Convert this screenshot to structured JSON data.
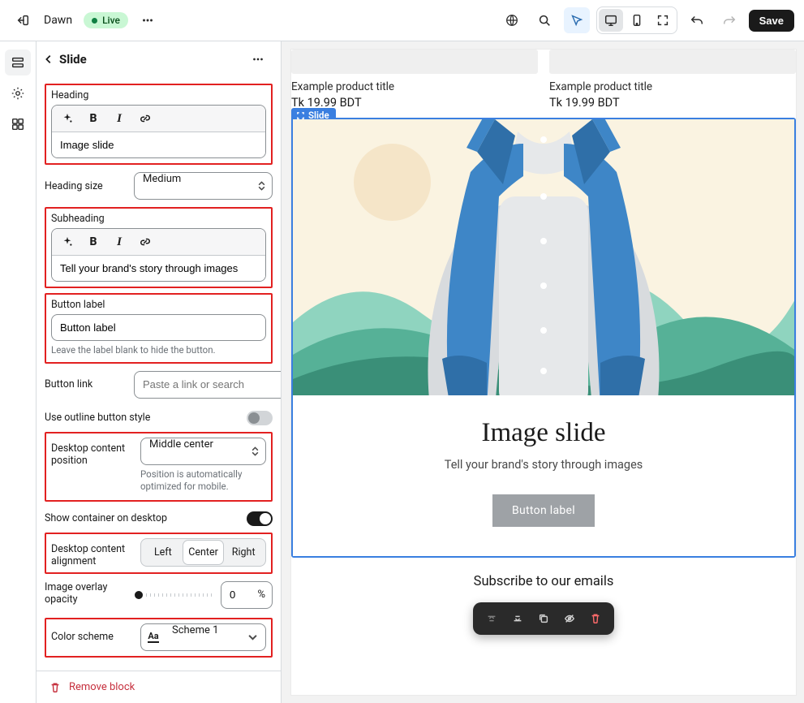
{
  "app": {
    "theme_name": "Dawn",
    "status_label": "Live",
    "save_label": "Save"
  },
  "sidebar": {
    "title": "Slide",
    "heading_label": "Heading",
    "heading_value": "Image slide",
    "heading_size_label": "Heading size",
    "heading_size_value": "Medium",
    "subheading_label": "Subheading",
    "subheading_value": "Tell your brand's story through images",
    "button_label_label": "Button label",
    "button_label_value": "Button label",
    "button_label_hint": "Leave the label blank to hide the button.",
    "button_link_label": "Button link",
    "button_link_placeholder": "Paste a link or search",
    "outline_toggle_label": "Use outline button style",
    "desktop_position_label": "Desktop content position",
    "desktop_position_value": "Middle center",
    "desktop_position_hint": "Position is automatically optimized for mobile.",
    "show_container_label": "Show container on desktop",
    "alignment_label": "Desktop content alignment",
    "alignment_options": {
      "left": "Left",
      "center": "Center",
      "right": "Right"
    },
    "opacity_label": "Image overlay opacity",
    "opacity_value": "0",
    "opacity_unit": "%",
    "scheme_label": "Color scheme",
    "scheme_value": "Scheme 1",
    "remove_label": "Remove block"
  },
  "preview": {
    "product1_title": "Example product title",
    "product1_price": "Tk 19.99 BDT",
    "product2_title": "Example product title",
    "product2_price": "Tk 19.99 BDT",
    "slide_badge": "Slide",
    "slide_heading": "Image slide",
    "slide_subheading": "Tell your brand's story through images",
    "slide_button": "Button label",
    "newsletter_heading": "Subscribe to our emails"
  }
}
